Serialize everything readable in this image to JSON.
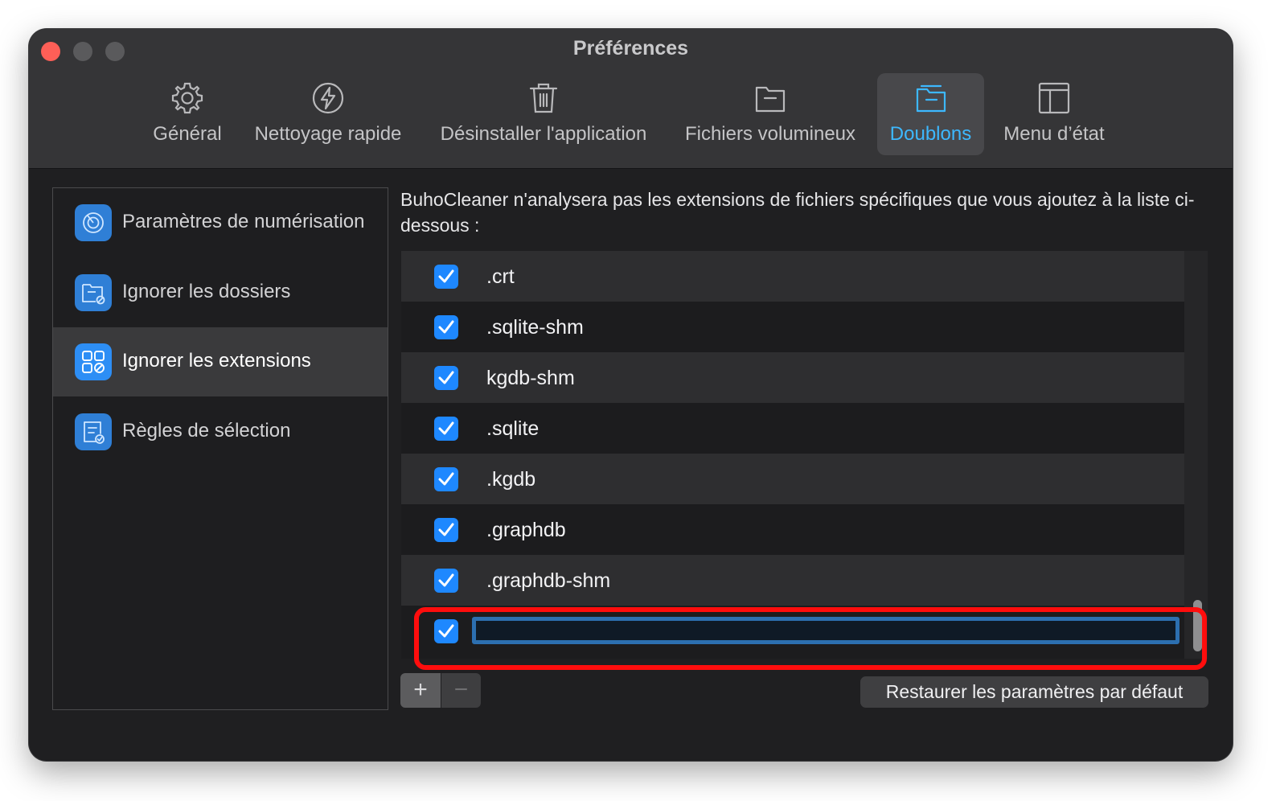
{
  "window": {
    "title": "Préférences"
  },
  "tabs": [
    {
      "label": "Général",
      "icon": "gear-icon"
    },
    {
      "label": "Nettoyage rapide",
      "icon": "lightning-icon"
    },
    {
      "label": "Désinstaller l'application",
      "icon": "trash-icon"
    },
    {
      "label": "Fichiers volumineux",
      "icon": "folder-icon"
    },
    {
      "label": "Doublons",
      "icon": "duplicate-folder-icon",
      "active": true
    },
    {
      "label": "Menu d’état",
      "icon": "menu-layout-icon"
    }
  ],
  "sidebar": {
    "items": [
      {
        "label": "Paramètres de numérisation",
        "icon": "scan-radar-icon"
      },
      {
        "label": "Ignorer les dossiers",
        "icon": "folder-ignore-icon"
      },
      {
        "label": "Ignorer les extensions",
        "icon": "extensions-grid-icon",
        "selected": true
      },
      {
        "label": "Règles de sélection",
        "icon": "selection-rules-icon"
      }
    ]
  },
  "main": {
    "description": "BuhoCleaner n'analysera pas les extensions de fichiers spécifiques que vous ajoutez à la liste ci-dessous :",
    "extensions": [
      {
        "name": ".crt",
        "checked": true
      },
      {
        "name": ".sqlite-shm",
        "checked": true
      },
      {
        "name": "kgdb-shm",
        "checked": true
      },
      {
        "name": ".sqlite",
        "checked": true
      },
      {
        "name": ".kgdb",
        "checked": true
      },
      {
        "name": ".graphdb",
        "checked": true
      },
      {
        "name": ".graphdb-shm",
        "checked": true
      }
    ],
    "new_entry": {
      "value": "",
      "checked": true
    },
    "add_label": "+",
    "remove_label": "−",
    "restore_label": "Restaurer les paramètres par défaut"
  },
  "colors": {
    "accent": "#3db8ff",
    "checkbox": "#1e88ff",
    "highlight": "#ff0d0d"
  }
}
